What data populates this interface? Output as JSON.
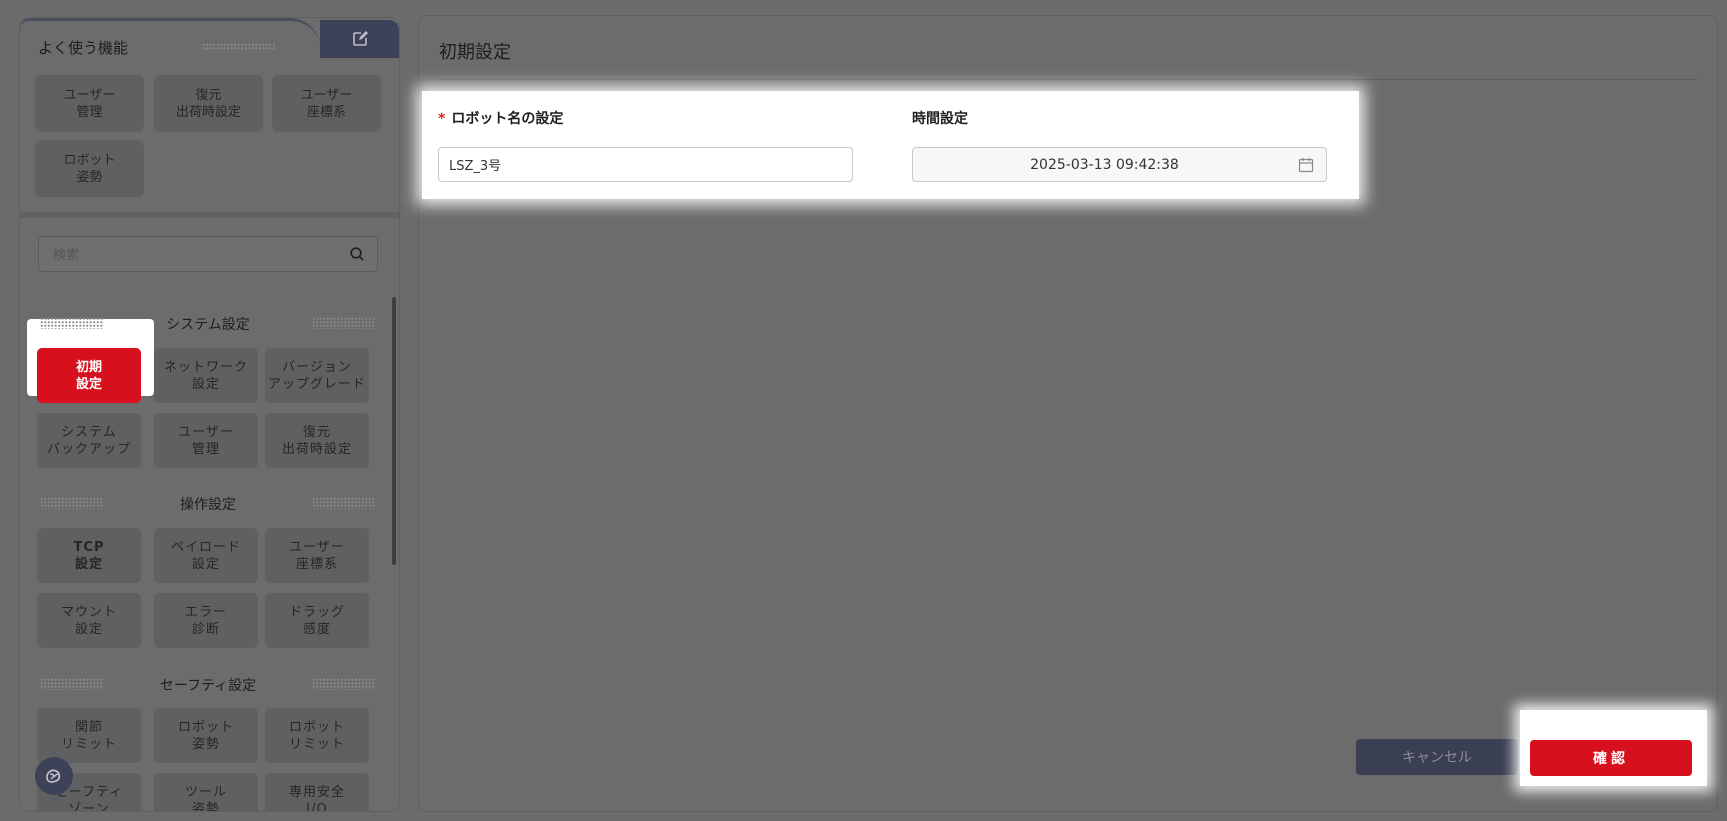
{
  "sidebar": {
    "favorites_title": "よく使う機能",
    "favorites": [
      {
        "label": "ユーザー\n管理"
      },
      {
        "label": "復元\n出荷時設定"
      },
      {
        "label": "ユーザー\n座標系"
      },
      {
        "label": "ロボット\n姿勢"
      }
    ],
    "search_placeholder": "検索",
    "categories": [
      {
        "title": "システム設定",
        "items": [
          {
            "label": "初期\n設定",
            "active": true
          },
          {
            "label": "ネットワーク\n設定"
          },
          {
            "label": "バージョン\nアップグレード"
          },
          {
            "label": "システム\nバックアップ"
          },
          {
            "label": "ユーザー\n管理"
          },
          {
            "label": "復元\n出荷時設定"
          }
        ]
      },
      {
        "title": "操作設定",
        "items": [
          {
            "label": "TCP\n設定"
          },
          {
            "label": "ペイロード\n設定"
          },
          {
            "label": "ユーザー\n座標系"
          },
          {
            "label": "マウント\n設定"
          },
          {
            "label": "エラー\n診断"
          },
          {
            "label": "ドラッグ\n感度"
          }
        ]
      },
      {
        "title": "セーフティ設定",
        "items": [
          {
            "label": "関節\nリミット"
          },
          {
            "label": "ロボット\n姿勢"
          },
          {
            "label": "ロボット\nリミット"
          },
          {
            "label": "セーフティ\nゾーン"
          },
          {
            "label": "ツール\n姿勢"
          },
          {
            "label": "専用安全\nI/O"
          }
        ]
      }
    ]
  },
  "main": {
    "title": "初期設定",
    "robot_name_label": "ロボット名の設定",
    "required_mark": "*",
    "robot_name_value": "LSZ_3号",
    "time_label": "時間設定",
    "time_value": "2025-03-13 09:42:38",
    "cancel_label": "キャンセル",
    "confirm_label": "確認"
  },
  "colors": {
    "accent_red": "#d6101c",
    "navy": "#3d4258"
  },
  "icons": [
    "edit-icon",
    "search-icon",
    "calendar-icon",
    "assistant-icon"
  ]
}
